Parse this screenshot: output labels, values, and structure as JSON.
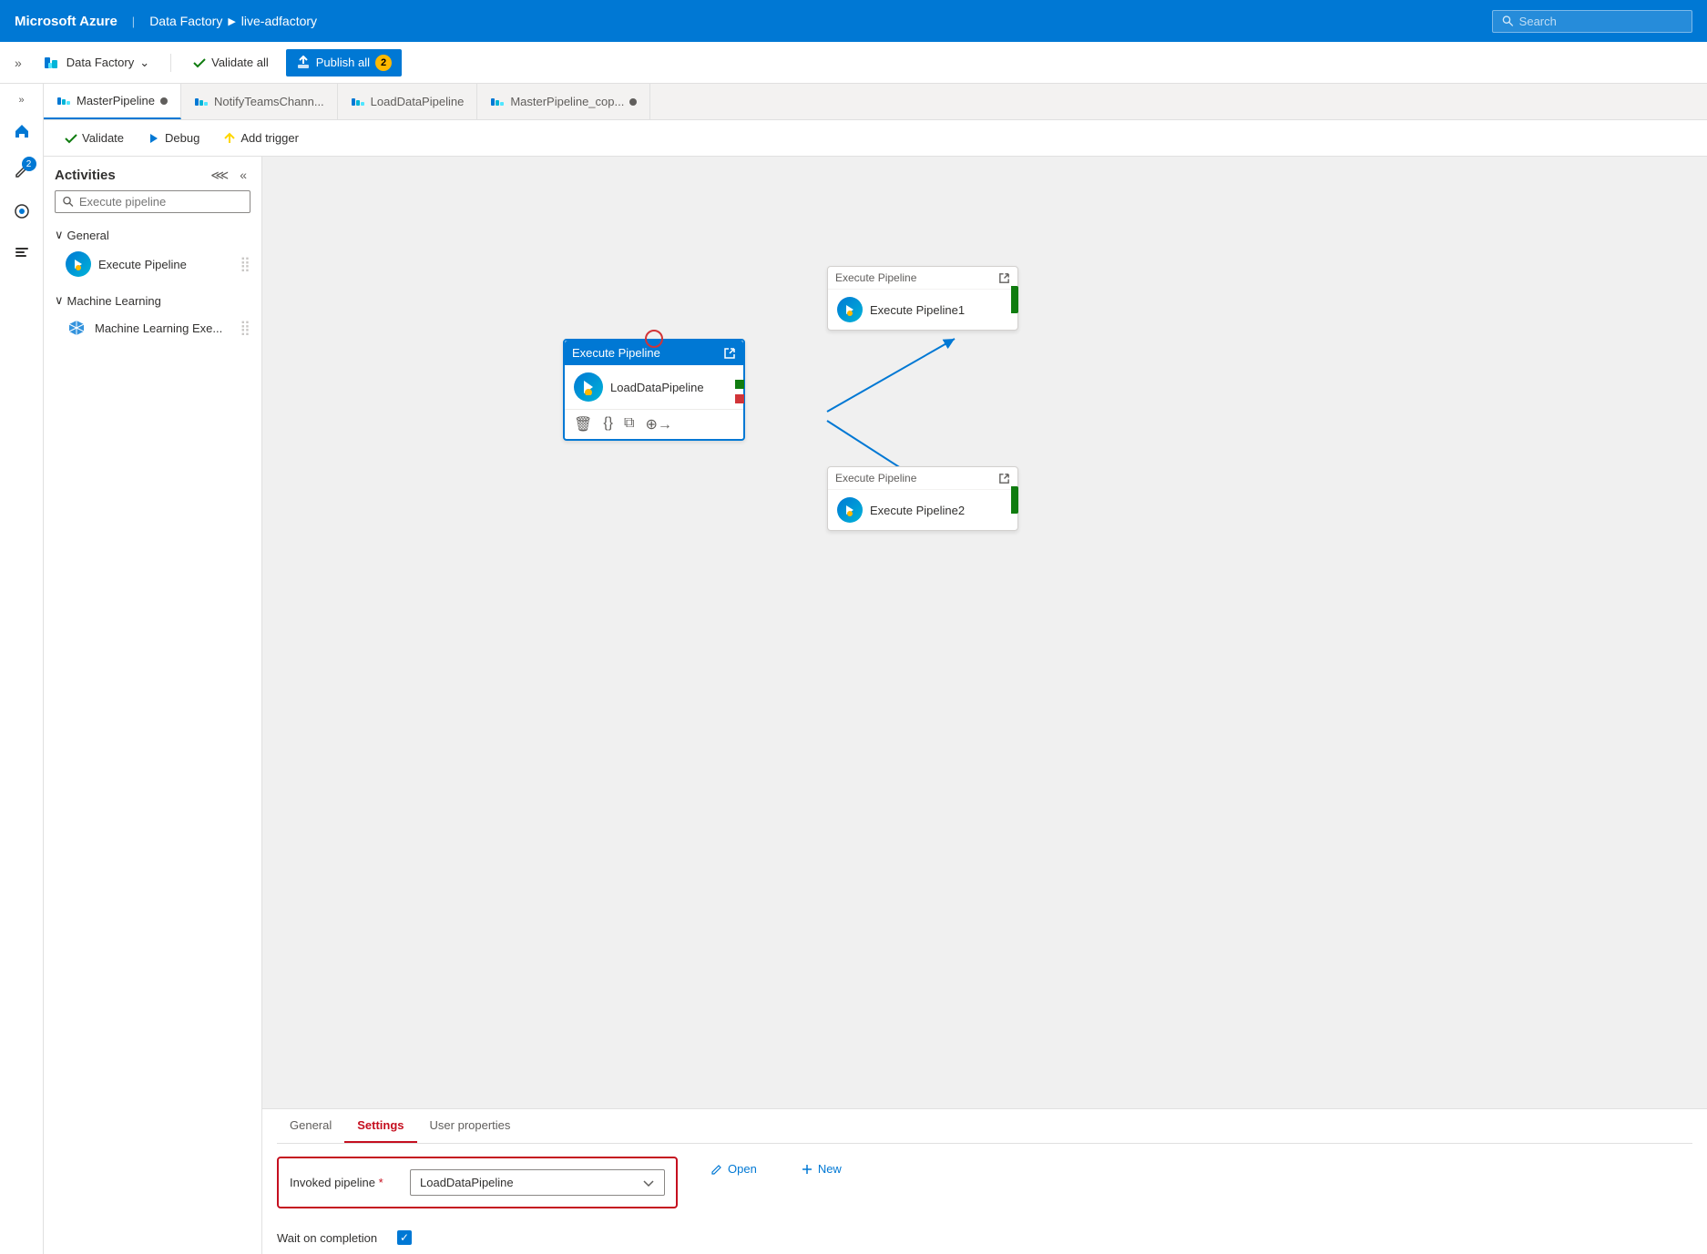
{
  "topbar": {
    "brand": "Microsoft Azure",
    "separator": "|",
    "breadcrumb": [
      "Data Factory",
      "▶",
      "live-adfactory"
    ],
    "search_placeholder": "Search"
  },
  "toolbar2": {
    "expand_icon": "»",
    "data_factory_label": "Data Factory",
    "chevron": "⌄",
    "validate_label": "Validate all",
    "publish_label": "Publish all",
    "publish_badge": "2"
  },
  "tabs": [
    {
      "label": "MasterPipeline",
      "active": true,
      "has_dot": true
    },
    {
      "label": "NotifyTeamsChann...",
      "active": false,
      "has_dot": false
    },
    {
      "label": "LoadDataPipeline",
      "active": false,
      "has_dot": false
    },
    {
      "label": "MasterPipeline_cop...",
      "active": false,
      "has_dot": true
    }
  ],
  "pipeline_actions": {
    "validate_label": "Validate",
    "debug_label": "Debug",
    "add_trigger_label": "Add trigger"
  },
  "activities": {
    "title": "Activities",
    "search_placeholder": "Execute pipeline",
    "sections": [
      {
        "title": "General",
        "items": [
          {
            "label": "Execute Pipeline"
          }
        ]
      },
      {
        "title": "Machine Learning",
        "items": [
          {
            "label": "Machine Learning Exe..."
          }
        ]
      }
    ]
  },
  "canvas": {
    "main_node": {
      "header": "Execute Pipeline",
      "body": "LoadDataPipeline"
    },
    "node1": {
      "header": "Execute Pipeline",
      "body": "Execute Pipeline1"
    },
    "node2": {
      "header": "Execute Pipeline",
      "body": "Execute Pipeline2"
    }
  },
  "bottom_panel": {
    "tabs": [
      {
        "label": "General",
        "active": false
      },
      {
        "label": "Settings",
        "active": true
      },
      {
        "label": "User properties",
        "active": false
      }
    ],
    "invoked_pipeline_label": "Invoked pipeline",
    "invoked_pipeline_required": "*",
    "invoked_pipeline_value": "LoadDataPipeline",
    "wait_label": "Wait on completion",
    "open_label": "Open",
    "new_label": "New"
  }
}
